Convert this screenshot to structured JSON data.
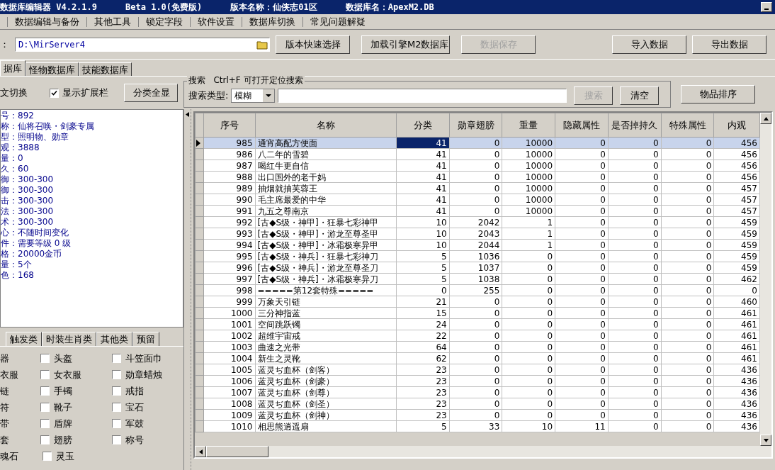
{
  "title_bar": {
    "segments": [
      "数据库编辑器 V4.2.1.9",
      "Beta 1.0(免费版)",
      "版本名称：仙侠志01区",
      "数据库名：ApexM2.DB"
    ]
  },
  "menu": [
    "数据编辑与备份",
    "其他工具",
    "锁定字段",
    "软件设置",
    "数据库切换",
    "常见问题解疑"
  ],
  "path": {
    "label": "：",
    "value": "D:\\MirServer4"
  },
  "toolbar_buttons": [
    {
      "label": "版本快速选择",
      "disabled": false
    },
    {
      "label": "加载引擎M2数据库",
      "disabled": false
    },
    {
      "label": "数据保存",
      "disabled": true
    },
    {
      "label": "导入数据",
      "disabled": false
    },
    {
      "label": "导出数据",
      "disabled": false
    }
  ],
  "db_tabs": [
    {
      "label": "据库",
      "selected": true
    },
    {
      "label": "怪物数据库",
      "selected": false
    },
    {
      "label": "技能数据库",
      "selected": false
    }
  ],
  "options": {
    "toggle_label": "文切换",
    "show_ext": {
      "label": "显示扩展栏",
      "checked": true
    },
    "show_all_button": "分类全显"
  },
  "search": {
    "group_title": "搜索   Ctrl+F 可打开定位搜索",
    "type_label": "搜索类型:",
    "type_value": "模糊",
    "buttons": [
      {
        "label": "搜索",
        "disabled": true
      },
      {
        "label": "清空",
        "disabled": false
      }
    ],
    "sort_button": "物品排序"
  },
  "info": [
    "号：892",
    "称：仙将召唤・剑豪专属",
    "型：照明物、勋章",
    "观：3888",
    "量：0",
    "久：60",
    "御：300-300",
    "御：300-300",
    "击：300-300",
    "法：300-300",
    "术：300-300",
    "心：不随时间变化",
    "件：需要等级 0 级",
    "格：20000金币",
    "量：5个",
    "色：168"
  ],
  "category_tabs": [
    {
      "label": "触发类",
      "selected": false
    },
    {
      "label": "时装生肖类",
      "selected": false
    },
    {
      "label": "其他类",
      "selected": false
    },
    {
      "label": "预留",
      "selected": false
    }
  ],
  "checkbox_rows": [
    {
      "first": "器",
      "items": [
        {
          "label": "头盔",
          "checked": false
        },
        {
          "label": "斗笠面巾",
          "checked": false
        }
      ]
    },
    {
      "first": "衣服",
      "items": [
        {
          "label": "女衣服",
          "checked": false
        },
        {
          "label": "勋章蜡烛",
          "checked": false
        }
      ]
    },
    {
      "first": "链",
      "items": [
        {
          "label": "手镯",
          "checked": false
        },
        {
          "label": "戒指",
          "checked": false
        }
      ]
    },
    {
      "first": "符",
      "items": [
        {
          "label": "靴子",
          "checked": false
        },
        {
          "label": "宝石",
          "checked": false
        }
      ]
    },
    {
      "first": "带",
      "items": [
        {
          "label": "盾牌",
          "checked": false
        },
        {
          "label": "军鼓",
          "checked": false
        }
      ]
    },
    {
      "first": "套",
      "items": [
        {
          "label": "翅膀",
          "checked": false
        },
        {
          "label": "称号",
          "checked": false
        }
      ]
    },
    {
      "first": "魂石",
      "items": [
        {
          "label": "灵玉",
          "checked": false
        }
      ]
    }
  ],
  "table": {
    "columns": [
      "序号",
      "名称",
      "分类",
      "勋章翅膀",
      "重量",
      "隐藏属性",
      "是否掉持久",
      "特殊属性",
      "内观"
    ],
    "rows": [
      {
        "selected": true,
        "cells": [
          "985",
          "通宵高配方便面",
          "41",
          "0",
          "10000",
          "0",
          "0",
          "0",
          "456"
        ]
      },
      {
        "selected": false,
        "cells": [
          "986",
          "八二年的雪碧",
          "41",
          "0",
          "10000",
          "0",
          "0",
          "0",
          "456"
        ]
      },
      {
        "selected": false,
        "cells": [
          "987",
          "喝红牛更自信",
          "41",
          "0",
          "10000",
          "0",
          "0",
          "0",
          "456"
        ]
      },
      {
        "selected": false,
        "cells": [
          "988",
          "出口国外的老干妈",
          "41",
          "0",
          "10000",
          "0",
          "0",
          "0",
          "456"
        ]
      },
      {
        "selected": false,
        "cells": [
          "989",
          "抽烟就抽芙蓉王",
          "41",
          "0",
          "10000",
          "0",
          "0",
          "0",
          "457"
        ]
      },
      {
        "selected": false,
        "cells": [
          "990",
          "毛主席最爱的中华",
          "41",
          "0",
          "10000",
          "0",
          "0",
          "0",
          "457"
        ]
      },
      {
        "selected": false,
        "cells": [
          "991",
          "九五之尊南京",
          "41",
          "0",
          "10000",
          "0",
          "0",
          "0",
          "457"
        ]
      },
      {
        "selected": false,
        "cells": [
          "992",
          "[古◆S级・神甲]・狂暴七彩神甲",
          "10",
          "2042",
          "1",
          "0",
          "0",
          "0",
          "459"
        ]
      },
      {
        "selected": false,
        "cells": [
          "993",
          "[古◆S级・神甲]・游龙至尊圣甲",
          "10",
          "2043",
          "1",
          "0",
          "0",
          "0",
          "459"
        ]
      },
      {
        "selected": false,
        "cells": [
          "994",
          "[古◆S级・神甲]・冰霜极寒异甲",
          "10",
          "2044",
          "1",
          "0",
          "0",
          "0",
          "459"
        ]
      },
      {
        "selected": false,
        "cells": [
          "995",
          "[古◆S级・神兵]・狂暴七彩神刀",
          "5",
          "1036",
          "0",
          "0",
          "0",
          "0",
          "459"
        ]
      },
      {
        "selected": false,
        "cells": [
          "996",
          "[古◆S级・神兵]・游龙至尊圣刀",
          "5",
          "1037",
          "0",
          "0",
          "0",
          "0",
          "459"
        ]
      },
      {
        "selected": false,
        "cells": [
          "997",
          "[古◆S级・神兵]・冰霜极寒异刀",
          "5",
          "1038",
          "0",
          "0",
          "0",
          "0",
          "462"
        ]
      },
      {
        "selected": false,
        "cells": [
          "998",
          "=====第12套特殊=====",
          "0",
          "255",
          "0",
          "0",
          "0",
          "0",
          "0"
        ]
      },
      {
        "selected": false,
        "cells": [
          "999",
          "万象天引链",
          "21",
          "0",
          "0",
          "0",
          "0",
          "0",
          "460"
        ]
      },
      {
        "selected": false,
        "cells": [
          "1000",
          "三分神指蓝",
          "15",
          "0",
          "0",
          "0",
          "0",
          "0",
          "461"
        ]
      },
      {
        "selected": false,
        "cells": [
          "1001",
          "空间跳跃镯",
          "24",
          "0",
          "0",
          "0",
          "0",
          "0",
          "461"
        ]
      },
      {
        "selected": false,
        "cells": [
          "1002",
          "超维宇宙戒",
          "22",
          "0",
          "0",
          "0",
          "0",
          "0",
          "461"
        ]
      },
      {
        "selected": false,
        "cells": [
          "1003",
          "曲速之光带",
          "64",
          "0",
          "0",
          "0",
          "0",
          "0",
          "461"
        ]
      },
      {
        "selected": false,
        "cells": [
          "1004",
          "新生之灵靴",
          "62",
          "0",
          "0",
          "0",
          "0",
          "0",
          "461"
        ]
      },
      {
        "selected": false,
        "cells": [
          "1005",
          "蓝灵ぢ血杯（剑客）",
          "23",
          "0",
          "0",
          "0",
          "0",
          "0",
          "436"
        ]
      },
      {
        "selected": false,
        "cells": [
          "1006",
          "蓝灵ぢ血杯（剑豪）",
          "23",
          "0",
          "0",
          "0",
          "0",
          "0",
          "436"
        ]
      },
      {
        "selected": false,
        "cells": [
          "1007",
          "蓝灵ぢ血杯（剑尊）",
          "23",
          "0",
          "0",
          "0",
          "0",
          "0",
          "436"
        ]
      },
      {
        "selected": false,
        "cells": [
          "1008",
          "蓝灵ぢ血杯（剑圣）",
          "23",
          "0",
          "0",
          "0",
          "0",
          "0",
          "436"
        ]
      },
      {
        "selected": false,
        "cells": [
          "1009",
          "蓝灵ぢ血杯（剑神）",
          "23",
          "0",
          "0",
          "0",
          "0",
          "0",
          "436"
        ]
      },
      {
        "selected": false,
        "cells": [
          "1010",
          "相思熊逍遥扇",
          "5",
          "33",
          "10",
          "11",
          "0",
          "0",
          "436"
        ]
      }
    ]
  }
}
